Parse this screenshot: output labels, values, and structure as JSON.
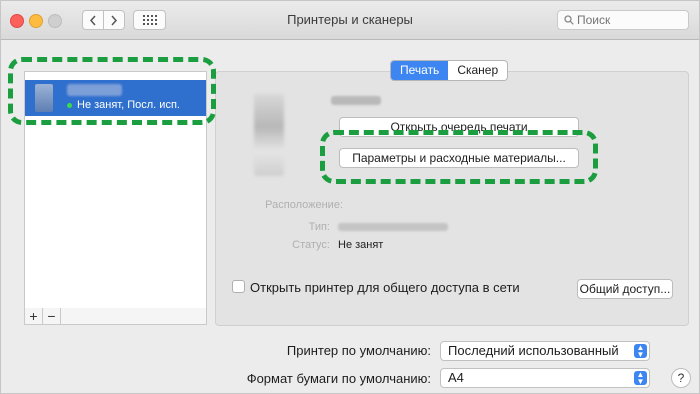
{
  "window": {
    "title": "Принтеры и сканеры"
  },
  "search": {
    "placeholder": "Поиск"
  },
  "printer_list": {
    "items": [
      {
        "status": "Не занят, Посл. исп.",
        "status_color": "#3bdc4b",
        "selected": true
      }
    ],
    "add_label": "+",
    "remove_label": "−"
  },
  "tabs": [
    {
      "label": "Печать",
      "active": true
    },
    {
      "label": "Сканер",
      "active": false
    }
  ],
  "buttons": {
    "open_queue": "Открыть очередь печати",
    "options_supplies": "Параметры и расходные материалы...",
    "sharing": "Общий доступ..."
  },
  "info": {
    "location_label": "Расположение:",
    "type_label": "Тип:",
    "status_label": "Статус:",
    "status_value": "Не занят"
  },
  "share_checkbox": {
    "label": "Открыть принтер для общего доступа в сети",
    "checked": false
  },
  "defaults": {
    "printer_label": "Принтер по умолчанию:",
    "printer_value": "Последний использованный",
    "paper_label": "Формат бумаги по умолчанию:",
    "paper_value": "A4"
  },
  "help_label": "?",
  "colors": {
    "accent": "#3d86f2",
    "selection": "#2f6fcd",
    "highlight": "#1a9e3f"
  }
}
